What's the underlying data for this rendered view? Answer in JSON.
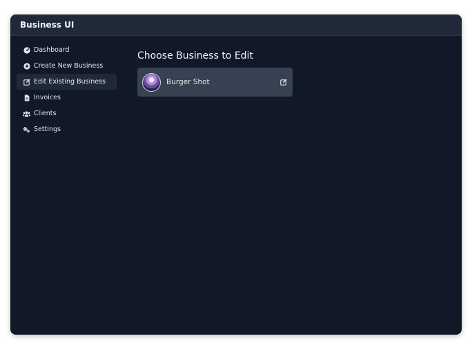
{
  "app": {
    "title": "Business UI"
  },
  "sidebar": {
    "items": [
      {
        "label": "Dashboard",
        "icon": "gauge-icon",
        "active": false
      },
      {
        "label": "Create New Business",
        "icon": "plus-circle-icon",
        "active": false
      },
      {
        "label": "Edit Existing Business",
        "icon": "edit-icon",
        "active": true
      },
      {
        "label": "Invoices",
        "icon": "invoice-icon",
        "active": false
      },
      {
        "label": "Clients",
        "icon": "users-icon",
        "active": false
      },
      {
        "label": "Settings",
        "icon": "cogs-icon",
        "active": false
      }
    ]
  },
  "main": {
    "title": "Choose Business to Edit",
    "businesses": [
      {
        "name": "Burger Shot",
        "avatar": "business-avatar",
        "action_icon": "edit-icon"
      }
    ]
  },
  "colors": {
    "background": "#111827",
    "header": "#1f2937",
    "card": "#374151",
    "text": "#e5e7eb"
  }
}
